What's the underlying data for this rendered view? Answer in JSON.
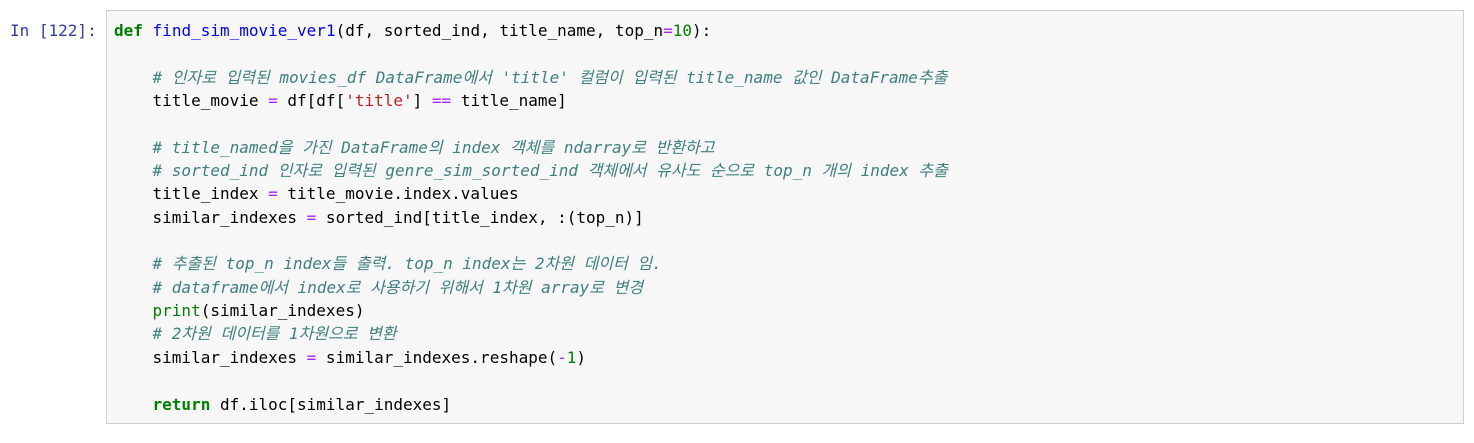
{
  "prompt": "In [122]:",
  "lines": [
    [
      {
        "t": "def",
        "c": "kw"
      },
      {
        "t": " "
      },
      {
        "t": "find_sim_movie_ver1",
        "c": "fn"
      },
      {
        "t": "(df, sorted_ind, title_name, top_n"
      },
      {
        "t": "=",
        "c": "op"
      },
      {
        "t": "10",
        "c": "num"
      },
      {
        "t": "):"
      }
    ],
    [],
    [
      {
        "t": "    "
      },
      {
        "t": "# 인자로 입력된 movies_df DataFrame에서 'title' 컬럼이 입력된 title_name 값인 DataFrame추출",
        "c": "cm"
      }
    ],
    [
      {
        "t": "    title_movie "
      },
      {
        "t": "=",
        "c": "op"
      },
      {
        "t": " df[df["
      },
      {
        "t": "'title'",
        "c": "str"
      },
      {
        "t": "] "
      },
      {
        "t": "==",
        "c": "op"
      },
      {
        "t": " title_name]"
      }
    ],
    [],
    [
      {
        "t": "    "
      },
      {
        "t": "# title_named을 가진 DataFrame의 index 객체를 ndarray로 반환하고",
        "c": "cm"
      }
    ],
    [
      {
        "t": "    "
      },
      {
        "t": "# sorted_ind 인자로 입력된 genre_sim_sorted_ind 객체에서 유사도 순으로 top_n 개의 index 추출",
        "c": "cm"
      }
    ],
    [
      {
        "t": "    title_index "
      },
      {
        "t": "=",
        "c": "op"
      },
      {
        "t": " title_movie.index.values"
      }
    ],
    [
      {
        "t": "    similar_indexes "
      },
      {
        "t": "=",
        "c": "op"
      },
      {
        "t": " sorted_ind[title_index, :(top_n)]"
      }
    ],
    [],
    [
      {
        "t": "    "
      },
      {
        "t": "# 추출된 top_n index들 출력. top_n index는 2차원 데이터 임.",
        "c": "cm"
      }
    ],
    [
      {
        "t": "    "
      },
      {
        "t": "# dataframe에서 index로 사용하기 위해서 1차원 array로 변경",
        "c": "cm"
      }
    ],
    [
      {
        "t": "    "
      },
      {
        "t": "print",
        "c": "bi"
      },
      {
        "t": "(similar_indexes)"
      }
    ],
    [
      {
        "t": "    "
      },
      {
        "t": "# 2차원 데이터를 1차원으로 변환",
        "c": "cm"
      }
    ],
    [
      {
        "t": "    similar_indexes "
      },
      {
        "t": "=",
        "c": "op"
      },
      {
        "t": " similar_indexes.reshape("
      },
      {
        "t": "-",
        "c": "op"
      },
      {
        "t": "1",
        "c": "num"
      },
      {
        "t": ")"
      }
    ],
    [],
    [
      {
        "t": "    "
      },
      {
        "t": "return",
        "c": "kw"
      },
      {
        "t": " df.iloc[similar_indexes]"
      }
    ]
  ]
}
